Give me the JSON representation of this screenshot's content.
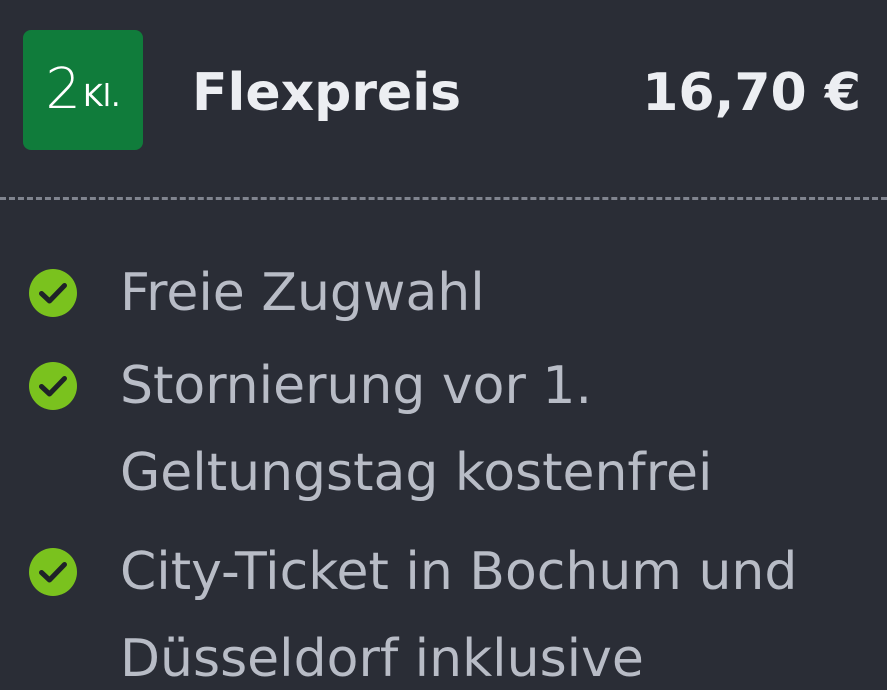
{
  "offer": {
    "class_number": "2",
    "class_suffix": "Kl.",
    "title": "Flexpreis",
    "price": "16,70 €"
  },
  "features": [
    {
      "icon": "check-circle-icon",
      "text": "Freie Zugwahl"
    },
    {
      "icon": "check-circle-icon",
      "text": "Stornierung vor 1. Geltungstag kostenfrei"
    },
    {
      "icon": "check-circle-icon",
      "text": "City-Ticket in Bochum und Düsseldorf inklusive"
    }
  ],
  "colors": {
    "background": "#2a2d36",
    "badge": "#107c3b",
    "check": "#7ac21e",
    "feature_text": "#b8bcc6",
    "heading_text": "#eceef2"
  }
}
